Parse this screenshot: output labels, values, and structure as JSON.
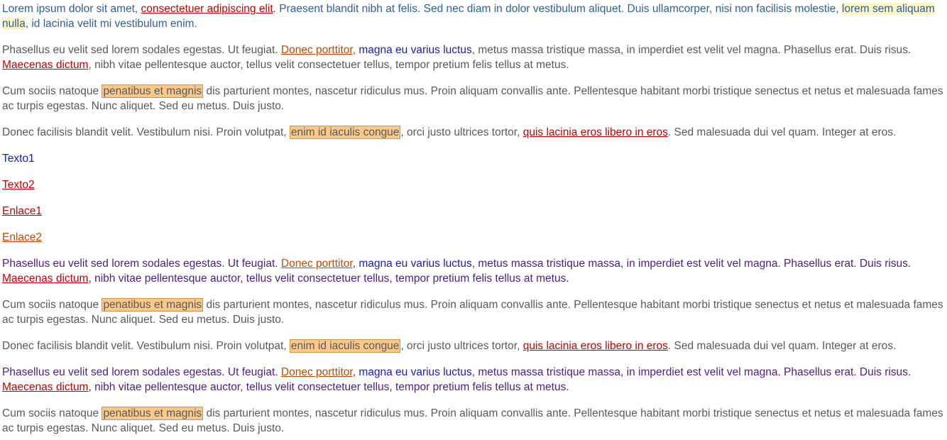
{
  "p1": {
    "t1": "Lorem ipsum dolor sit amet, ",
    "link1": "consectetuer adipiscing elit",
    "t2": ". Praesent blandit nibh at felis. Sed nec diam in dolor vestibulum aliquet. Duis ullamcorper, nisi non facilisis molestie, ",
    "highlight": "lorem sem aliquam nulla",
    "t3": ", id lacinia velit mi vestibulum enim."
  },
  "phasellus": {
    "t1": "Phasellus eu velit sed lorem sodales egestas. Ut feugiat. ",
    "link1": "Donec porttitor",
    "t2": ", ",
    "link2": "magna eu varius luctus",
    "t3": ", metus massa tristique massa, in imperdiet est velit vel magna. Phasellus erat. Duis risus. ",
    "link3": "Maecenas dictum",
    "t4": ", nibh vitae pellentesque auctor, tellus velit consectetuer tellus, tempor pretium felis tellus at metus."
  },
  "cum": {
    "t1": "Cum sociis natoque ",
    "highlight": "penatibus et magnis",
    "t2": " dis parturient montes, nascetur ridiculus mus. Proin aliquam convallis ante. Pellentesque habitant morbi tristique senectus et netus et malesuada fames ac turpis egestas. Nunc aliquet. Sed eu metus. Duis justo."
  },
  "donec": {
    "t1": "Donec facilisis blandit velit. Vestibulum nisi. Proin volutpat, ",
    "highlight": "enim id iaculis congue",
    "t2": ", orci justo ultrices tortor, ",
    "link1": "quis lacinia eros libero in eros",
    "t3": ". Sed malesuada dui vel quam. Integer at eros."
  },
  "items": {
    "texto1": "Texto1",
    "texto2": "Texto2",
    "enlace1": "Enlace1",
    "enlace2": "Enlace2"
  },
  "colors": {
    "blue_text": "#2f5f9e",
    "gray_text": "#5a5a5a",
    "purple_text": "#4a1f8a",
    "link_red": "#cc0000",
    "link_orange": "#c24a00",
    "link_blue": "#1a1ac8",
    "highlight_yellow": "#fbf6c4",
    "highlight_orange": "#f9c98b"
  }
}
